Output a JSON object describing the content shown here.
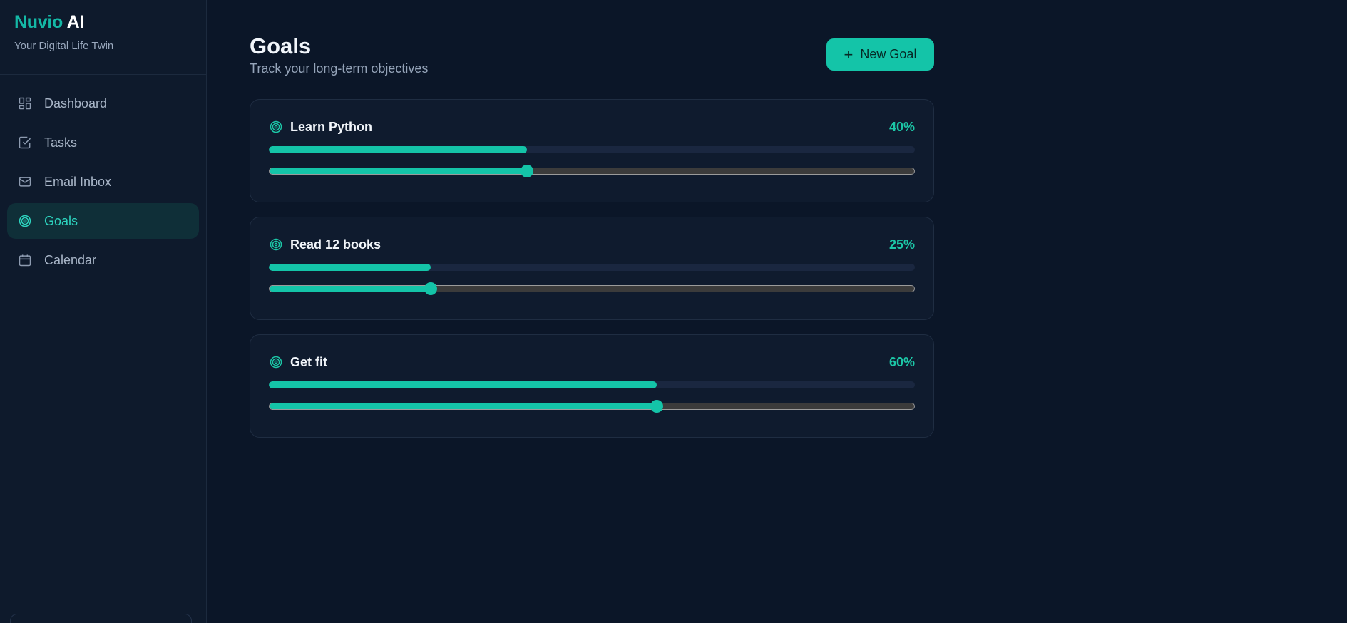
{
  "brand": {
    "name_accent": "Nuvio",
    "name_rest": "AI",
    "tagline": "Your Digital Life Twin"
  },
  "nav": [
    {
      "label": "Dashboard",
      "icon": "dashboard-icon",
      "active": false
    },
    {
      "label": "Tasks",
      "icon": "checkbox-icon",
      "active": false
    },
    {
      "label": "Email Inbox",
      "icon": "mail-icon",
      "active": false
    },
    {
      "label": "Goals",
      "icon": "target-icon",
      "active": true
    },
    {
      "label": "Calendar",
      "icon": "calendar-icon",
      "active": false
    }
  ],
  "header": {
    "title": "Goals",
    "subtitle": "Track your long-term objectives",
    "new_goal_label": "New Goal"
  },
  "goals": [
    {
      "name": "Learn Python",
      "progress": 40,
      "progress_label": "40%"
    },
    {
      "name": "Read 12 books",
      "progress": 25,
      "progress_label": "25%"
    },
    {
      "name": "Get fit",
      "progress": 60,
      "progress_label": "60%"
    }
  ],
  "colors": {
    "accent": "#14c4a8",
    "background": "#0b1628",
    "card": "#0f1b2e"
  }
}
